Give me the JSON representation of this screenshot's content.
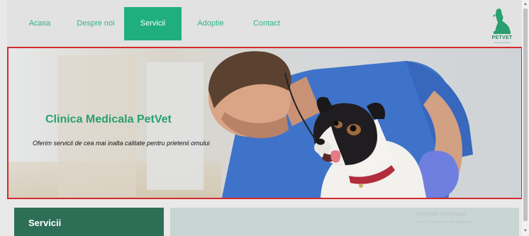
{
  "nav": {
    "items": [
      {
        "label": "Acasa",
        "active": false
      },
      {
        "label": "Despre noi",
        "active": false
      },
      {
        "label": "Servicii",
        "active": true
      },
      {
        "label": "Adoptie",
        "active": false
      },
      {
        "label": "Contact",
        "active": false
      }
    ],
    "logo": {
      "text": "PETVET",
      "sub": "Clinica Veterinara"
    }
  },
  "hero": {
    "title": "Clinica Medicala PetVet",
    "subtitle": "Oferim servicii de cea mai inalta calitate pentru prietenii omului"
  },
  "section": {
    "heading": "Servicii"
  },
  "watermark": {
    "line1": "Activate Windows",
    "line2": "Go to Settings to activate Windows."
  },
  "colors": {
    "accent": "#1faf7e",
    "nav_text": "#2fb48a",
    "hero_title": "#2a9f6f",
    "section_head": "#2d6e57",
    "hero_border": "#d62b2b"
  }
}
